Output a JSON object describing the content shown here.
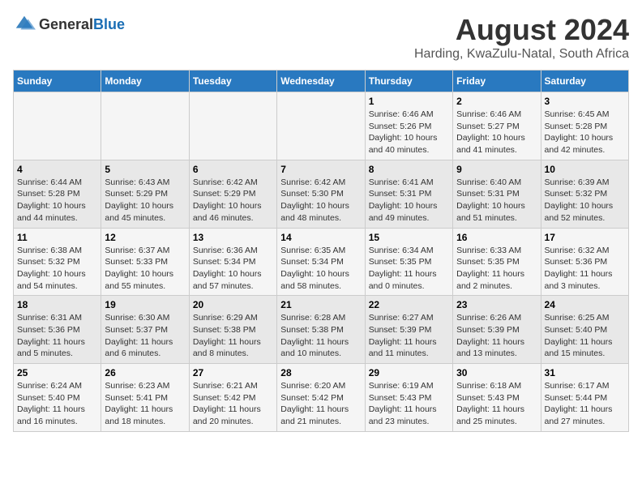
{
  "logo": {
    "general": "General",
    "blue": "Blue"
  },
  "title": "August 2024",
  "subtitle": "Harding, KwaZulu-Natal, South Africa",
  "days_of_week": [
    "Sunday",
    "Monday",
    "Tuesday",
    "Wednesday",
    "Thursday",
    "Friday",
    "Saturday"
  ],
  "weeks": [
    [
      {
        "day": "",
        "detail": ""
      },
      {
        "day": "",
        "detail": ""
      },
      {
        "day": "",
        "detail": ""
      },
      {
        "day": "",
        "detail": ""
      },
      {
        "day": "1",
        "detail": "Sunrise: 6:46 AM\nSunset: 5:26 PM\nDaylight: 10 hours\nand 40 minutes."
      },
      {
        "day": "2",
        "detail": "Sunrise: 6:46 AM\nSunset: 5:27 PM\nDaylight: 10 hours\nand 41 minutes."
      },
      {
        "day": "3",
        "detail": "Sunrise: 6:45 AM\nSunset: 5:28 PM\nDaylight: 10 hours\nand 42 minutes."
      }
    ],
    [
      {
        "day": "4",
        "detail": "Sunrise: 6:44 AM\nSunset: 5:28 PM\nDaylight: 10 hours\nand 44 minutes."
      },
      {
        "day": "5",
        "detail": "Sunrise: 6:43 AM\nSunset: 5:29 PM\nDaylight: 10 hours\nand 45 minutes."
      },
      {
        "day": "6",
        "detail": "Sunrise: 6:42 AM\nSunset: 5:29 PM\nDaylight: 10 hours\nand 46 minutes."
      },
      {
        "day": "7",
        "detail": "Sunrise: 6:42 AM\nSunset: 5:30 PM\nDaylight: 10 hours\nand 48 minutes."
      },
      {
        "day": "8",
        "detail": "Sunrise: 6:41 AM\nSunset: 5:31 PM\nDaylight: 10 hours\nand 49 minutes."
      },
      {
        "day": "9",
        "detail": "Sunrise: 6:40 AM\nSunset: 5:31 PM\nDaylight: 10 hours\nand 51 minutes."
      },
      {
        "day": "10",
        "detail": "Sunrise: 6:39 AM\nSunset: 5:32 PM\nDaylight: 10 hours\nand 52 minutes."
      }
    ],
    [
      {
        "day": "11",
        "detail": "Sunrise: 6:38 AM\nSunset: 5:32 PM\nDaylight: 10 hours\nand 54 minutes."
      },
      {
        "day": "12",
        "detail": "Sunrise: 6:37 AM\nSunset: 5:33 PM\nDaylight: 10 hours\nand 55 minutes."
      },
      {
        "day": "13",
        "detail": "Sunrise: 6:36 AM\nSunset: 5:34 PM\nDaylight: 10 hours\nand 57 minutes."
      },
      {
        "day": "14",
        "detail": "Sunrise: 6:35 AM\nSunset: 5:34 PM\nDaylight: 10 hours\nand 58 minutes."
      },
      {
        "day": "15",
        "detail": "Sunrise: 6:34 AM\nSunset: 5:35 PM\nDaylight: 11 hours\nand 0 minutes."
      },
      {
        "day": "16",
        "detail": "Sunrise: 6:33 AM\nSunset: 5:35 PM\nDaylight: 11 hours\nand 2 minutes."
      },
      {
        "day": "17",
        "detail": "Sunrise: 6:32 AM\nSunset: 5:36 PM\nDaylight: 11 hours\nand 3 minutes."
      }
    ],
    [
      {
        "day": "18",
        "detail": "Sunrise: 6:31 AM\nSunset: 5:36 PM\nDaylight: 11 hours\nand 5 minutes."
      },
      {
        "day": "19",
        "detail": "Sunrise: 6:30 AM\nSunset: 5:37 PM\nDaylight: 11 hours\nand 6 minutes."
      },
      {
        "day": "20",
        "detail": "Sunrise: 6:29 AM\nSunset: 5:38 PM\nDaylight: 11 hours\nand 8 minutes."
      },
      {
        "day": "21",
        "detail": "Sunrise: 6:28 AM\nSunset: 5:38 PM\nDaylight: 11 hours\nand 10 minutes."
      },
      {
        "day": "22",
        "detail": "Sunrise: 6:27 AM\nSunset: 5:39 PM\nDaylight: 11 hours\nand 11 minutes."
      },
      {
        "day": "23",
        "detail": "Sunrise: 6:26 AM\nSunset: 5:39 PM\nDaylight: 11 hours\nand 13 minutes."
      },
      {
        "day": "24",
        "detail": "Sunrise: 6:25 AM\nSunset: 5:40 PM\nDaylight: 11 hours\nand 15 minutes."
      }
    ],
    [
      {
        "day": "25",
        "detail": "Sunrise: 6:24 AM\nSunset: 5:40 PM\nDaylight: 11 hours\nand 16 minutes."
      },
      {
        "day": "26",
        "detail": "Sunrise: 6:23 AM\nSunset: 5:41 PM\nDaylight: 11 hours\nand 18 minutes."
      },
      {
        "day": "27",
        "detail": "Sunrise: 6:21 AM\nSunset: 5:42 PM\nDaylight: 11 hours\nand 20 minutes."
      },
      {
        "day": "28",
        "detail": "Sunrise: 6:20 AM\nSunset: 5:42 PM\nDaylight: 11 hours\nand 21 minutes."
      },
      {
        "day": "29",
        "detail": "Sunrise: 6:19 AM\nSunset: 5:43 PM\nDaylight: 11 hours\nand 23 minutes."
      },
      {
        "day": "30",
        "detail": "Sunrise: 6:18 AM\nSunset: 5:43 PM\nDaylight: 11 hours\nand 25 minutes."
      },
      {
        "day": "31",
        "detail": "Sunrise: 6:17 AM\nSunset: 5:44 PM\nDaylight: 11 hours\nand 27 minutes."
      }
    ]
  ]
}
